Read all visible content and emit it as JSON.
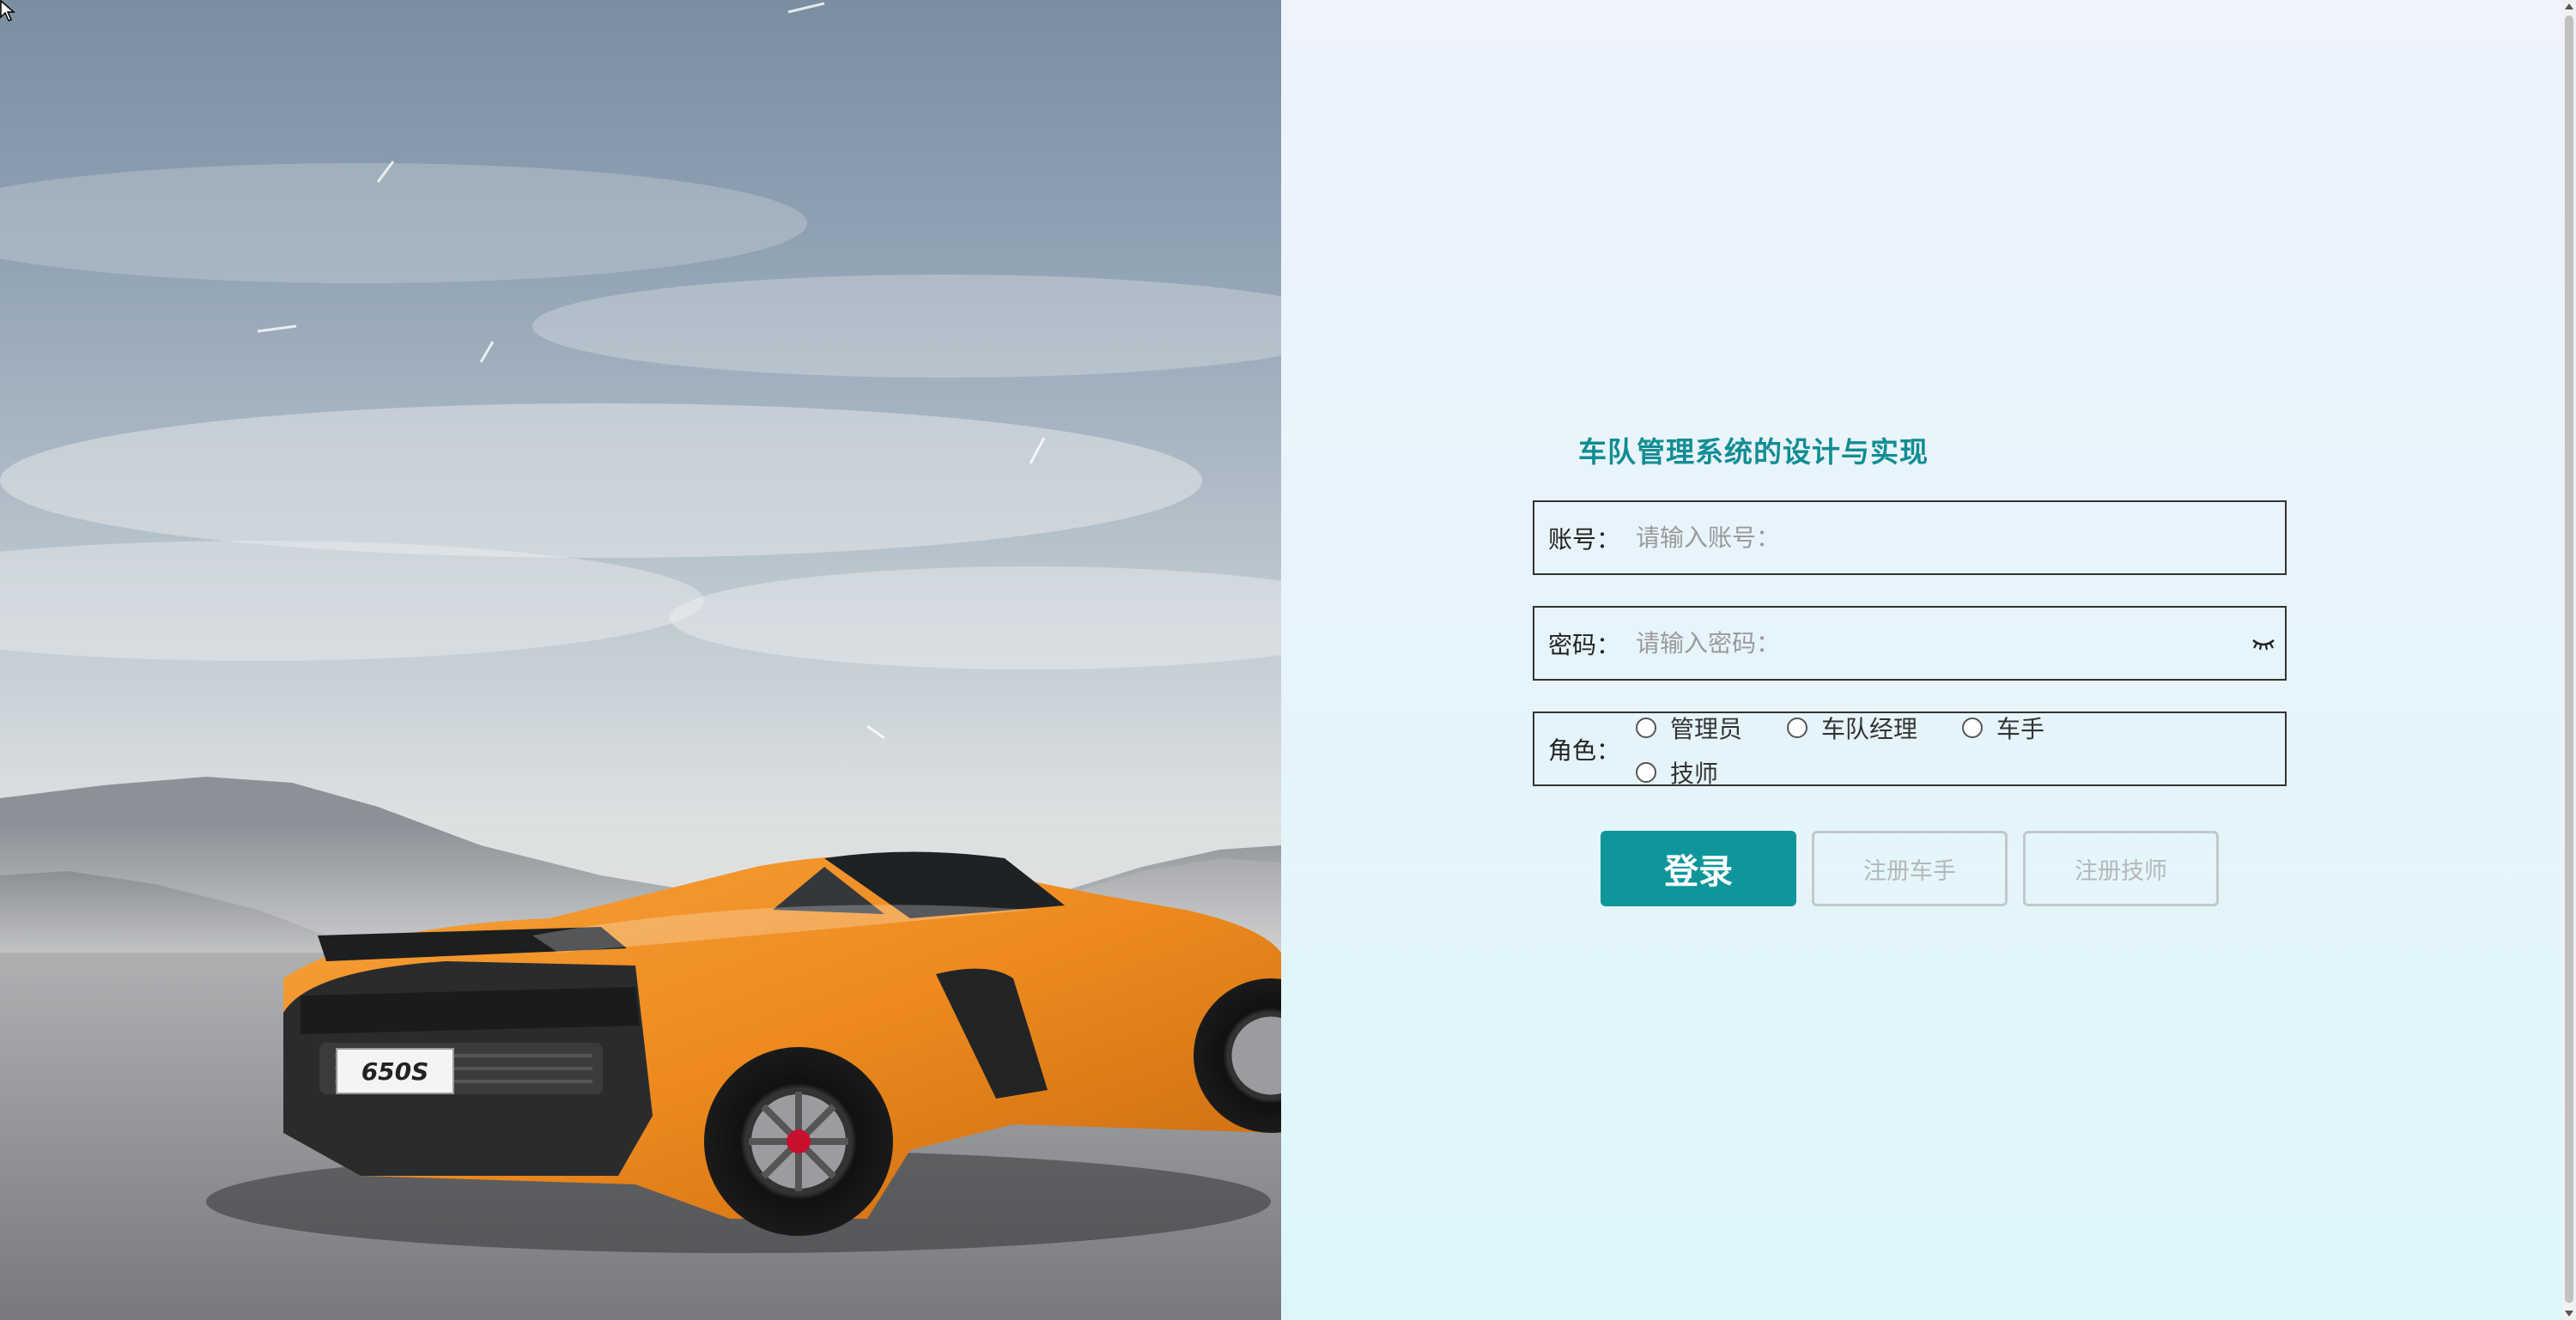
{
  "app": {
    "title": "车队管理系统的设计与实现"
  },
  "form": {
    "account": {
      "label": "账号：",
      "placeholder": "请输入账号：",
      "value": ""
    },
    "password": {
      "label": "密码：",
      "placeholder": "请输入密码：",
      "value": "",
      "toggle_icon": "eye-closed-icon"
    },
    "role": {
      "label": "角色：",
      "options": [
        "管理员",
        "车队经理",
        "车手",
        "技师"
      ],
      "selected": null
    }
  },
  "buttons": {
    "login": "登录",
    "register_driver": "注册车手",
    "register_technician": "注册技师"
  },
  "hero": {
    "plate_text": "650S",
    "car_color": "#f08a1c"
  },
  "colors": {
    "accent": "#0f969b",
    "title": "#128d93",
    "panel_bg": "#e7f4fb"
  }
}
